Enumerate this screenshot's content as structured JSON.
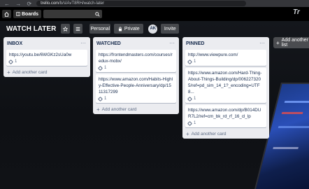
{
  "browser": {
    "nav_glyphs": "← → ⟳",
    "url_host": "trello.com",
    "url_path": "/b/sIAvT8RH/watch-later"
  },
  "header": {
    "home_icon": "home-icon",
    "boards_label": "Boards",
    "search_icon": "search-icon",
    "logo_text": "Tr"
  },
  "board": {
    "title": "WATCH LATER",
    "personal_label": "Personal",
    "private_label": "Private",
    "avatar_initials": "AK",
    "invite_label": "Invite"
  },
  "lists": [
    {
      "title": "INBOX",
      "cards": [
        {
          "text": "https://youtu.be/6WGKz2sUa0w",
          "attachments": "1"
        }
      ],
      "add_card_label": "Add another card"
    },
    {
      "title": "WATCHED",
      "cards": [
        {
          "text": "https://frontendmasters.com/courses/redux-mobx/",
          "attachments": "1"
        },
        {
          "text": "https://www.amazon.com/Habits-Highly-Effective-People-Anniversary/dp/1511317299",
          "attachments": "1"
        }
      ],
      "add_card_label": "Add another card"
    },
    {
      "title": "PINNED",
      "cards": [
        {
          "text": "http://www.viewpure.com/",
          "attachments": "1"
        },
        {
          "text": "https://www.amazon.com/Hard-Thing-About-Things-Building/dp/0062273205/ref=pd_sim_14_1?_encoding=UTF8...",
          "attachments": "1"
        },
        {
          "text": "https://www.amazon.com/dp/B014DUR7L2/ref=cm_bk_rd_rf_16_cl_lp",
          "attachments": "1"
        }
      ],
      "add_card_label": "Add another card"
    }
  ],
  "add_list_label": "Add another list",
  "colors": {
    "list_bg": "#ebecf0",
    "card_bg": "#ffffff",
    "text": "#172b4d",
    "muted": "#5e6c84"
  }
}
